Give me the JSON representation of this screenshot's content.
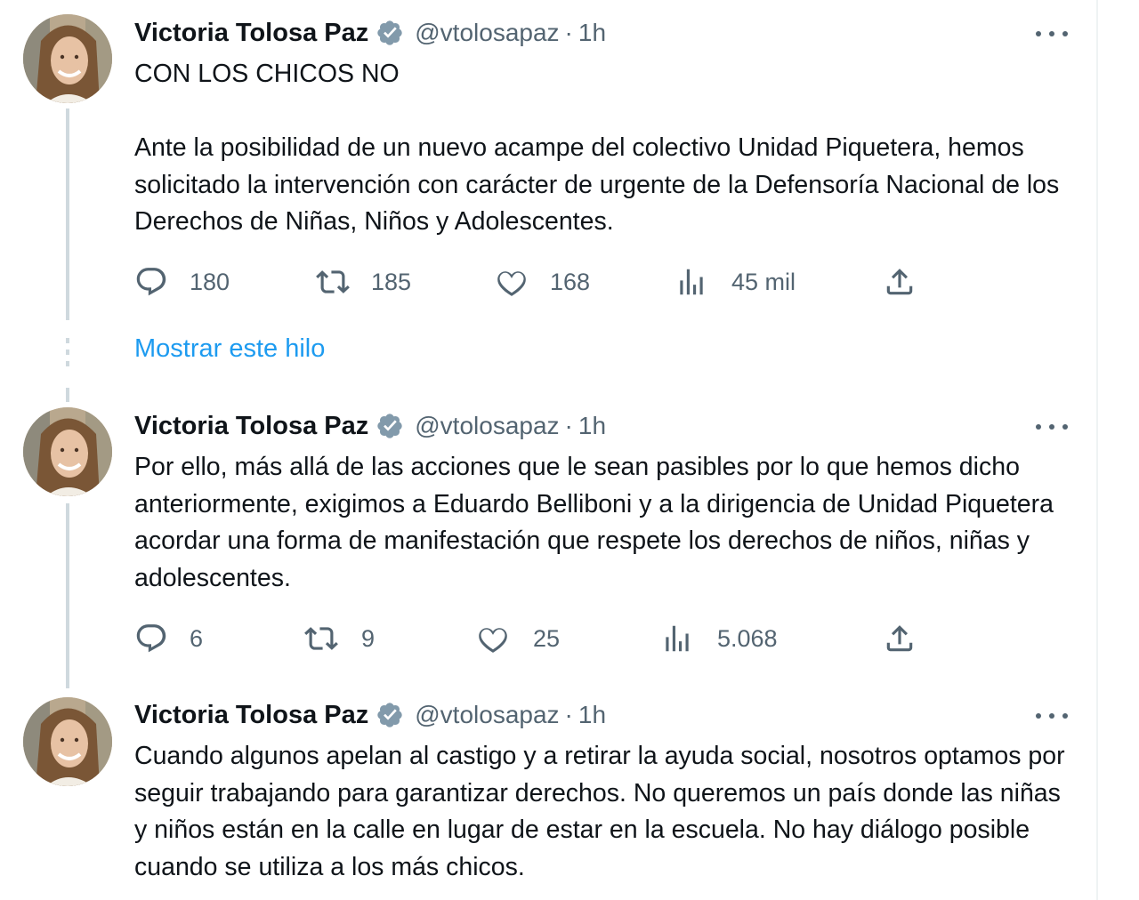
{
  "tweets": [
    {
      "name": "Victoria Tolosa Paz",
      "handle": "@vtolosapaz",
      "separator": "·",
      "time": "1h",
      "paragraphs": [
        "CON LOS CHICOS NO",
        "Ante la posibilidad de un nuevo acampe del colectivo Unidad Piquetera, hemos solicitado la intervención con carácter de urgente de la Defensoría Nacional de los Derechos de Niñas, Niños y Adolescentes."
      ],
      "stats": {
        "replies": "180",
        "retweets": "185",
        "likes": "168",
        "views": "45 mil"
      }
    },
    {
      "name": "Victoria Tolosa Paz",
      "handle": "@vtolosapaz",
      "separator": "·",
      "time": "1h",
      "paragraphs": [
        "Por ello, más allá de las acciones que le sean pasibles por lo que hemos dicho anteriormente, exigimos a Eduardo Belliboni y a la dirigencia de Unidad Piquetera acordar una forma de manifestación que respete los derechos de niños, niñas y adolescentes."
      ],
      "stats": {
        "replies": "6",
        "retweets": "9",
        "likes": "25",
        "views": "5.068"
      }
    },
    {
      "name": "Victoria Tolosa Paz",
      "handle": "@vtolosapaz",
      "separator": "·",
      "time": "1h",
      "paragraphs": [
        "Cuando algunos apelan al castigo y a retirar la ayuda social, nosotros optamos por seguir trabajando para garantizar derechos. No queremos un país donde las niñas y niños están en la calle en lugar de estar en la escuela. No hay diálogo posible cuando se utiliza a los más chicos."
      ]
    }
  ],
  "show_thread_label": "Mostrar este hilo",
  "icons": {
    "verified": "verified-badge-icon",
    "more": "more-options-icon",
    "reply": "reply-icon",
    "retweet": "retweet-icon",
    "like": "heart-icon",
    "views": "views-icon",
    "share": "share-icon"
  },
  "colors": {
    "text": "#0f1419",
    "secondary": "#536471",
    "link": "#1d9bf0",
    "thread_line": "#cfd9de",
    "badge": "#829aab"
  }
}
